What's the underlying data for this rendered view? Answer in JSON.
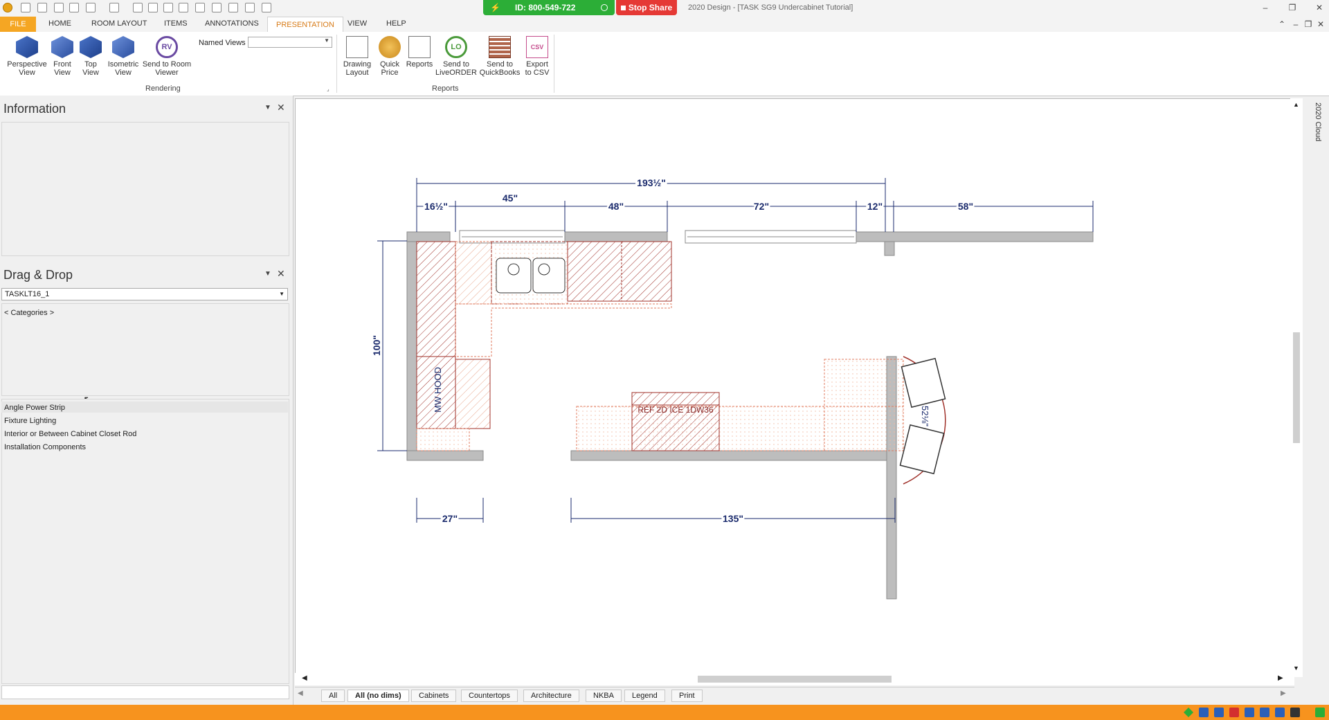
{
  "titlebar": {
    "share_id": "ID: 800-549-722",
    "stop_share": "Stop Share",
    "window_title": "2020 Design - [TASK SG9 Undercabinet Tutorial]"
  },
  "ribbon_tabs": [
    "FILE",
    "HOME",
    "ROOM LAYOUT",
    "ITEMS",
    "ANNOTATIONS",
    "PRESENTATION",
    "VIEW",
    "HELP"
  ],
  "ribbon": {
    "perspective": "Perspective View",
    "front": "Front View",
    "top": "Top View",
    "isometric": "Isometric View",
    "room_viewer": "Send to Room Viewer",
    "room_viewer_icon": "RV",
    "named_views_label": "Named Views",
    "named_views_value": "",
    "rendering_group": "Rendering",
    "drawing_layout": "Drawing Layout",
    "quick_price": "Quick Price",
    "reports": "Reports",
    "liveorder": "Send to LiveORDER",
    "liveorder_icon": "LO",
    "quickbooks": "Send to QuickBooks",
    "export_csv": "Export to CSV",
    "csv_icon": "CSV",
    "reports_group": "Reports"
  },
  "panels": {
    "information_title": "Information",
    "dragdrop_title": "Drag & Drop",
    "dragdrop_select": "TASKLT16_1",
    "categories": "< Categories >",
    "items": [
      "Angle Power Strip",
      "Fixture Lighting",
      "Interior or Between Cabinet Closet Rod",
      "Installation Components"
    ]
  },
  "drawing": {
    "dim_total": "193½\"",
    "dim_16": "16½\"",
    "dim_45": "45\"",
    "dim_48": "48\"",
    "dim_72": "72\"",
    "dim_12": "12\"",
    "dim_58": "58\"",
    "dim_100": "100\"",
    "dim_27": "27\"",
    "dim_135": "135\"",
    "dim_52": "52⅛\"",
    "label_mwhood": "MW HOOD",
    "label_ref": "REF 2D ICE 1DW36"
  },
  "sheet_tabs": [
    "All",
    "All (no dims)",
    "Cabinets",
    "Countertops",
    "Architecture",
    "NKBA",
    "Legend",
    "Print"
  ],
  "cloud_label": "2020 Cloud",
  "colors": {
    "accent": "#f7931e",
    "share_green": "#2cae37",
    "stop_red": "#e53935",
    "dim_blue": "#1a2a6c"
  }
}
